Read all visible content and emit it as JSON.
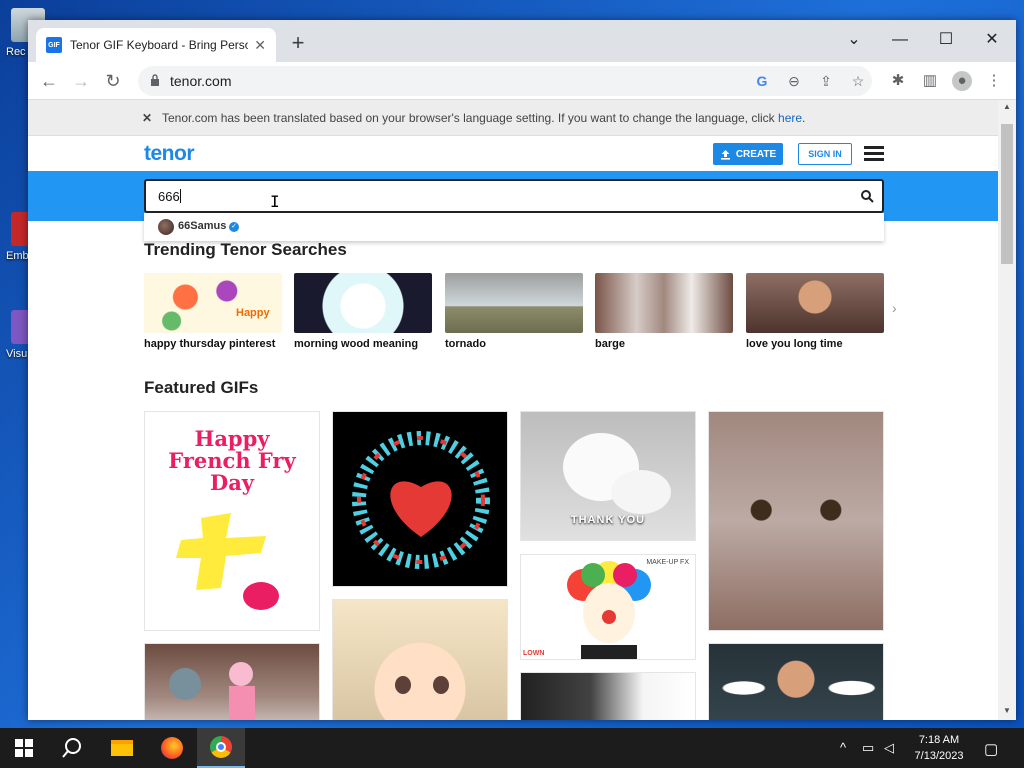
{
  "desktop": {
    "icons": [
      {
        "label": "Rec"
      },
      {
        "label": "Emb De"
      },
      {
        "label": "Visu"
      }
    ]
  },
  "browser": {
    "tab": {
      "title": "Tenor GIF Keyboard - Bring Personality",
      "favicon": "GIF"
    },
    "new_tab_glyph": "+",
    "address": {
      "url": "tenor.com"
    },
    "colors": {
      "accent": "#1e88e5",
      "band": "#2196f3"
    }
  },
  "translate_bar": {
    "message": "Tenor.com has been translated based on your browser's language setting. If you want to change the language, click ",
    "link": "here",
    "suffix": "."
  },
  "header": {
    "logo": "tenor",
    "create_label": "CREATE",
    "signin_label": "SIGN IN"
  },
  "search": {
    "value": "666",
    "suggestions": [
      {
        "name": "66Samus",
        "verified": true
      }
    ]
  },
  "trending": {
    "title": "Trending Tenor Searches",
    "items": [
      {
        "label": "happy thursday pinterest",
        "overlay": "Happy"
      },
      {
        "label": "morning wood meaning"
      },
      {
        "label": "tornado"
      },
      {
        "label": "barge"
      },
      {
        "label": "love you long time"
      }
    ]
  },
  "featured": {
    "title": "Featured GIFs",
    "gifs": [
      {
        "name": "happy-french-fry-day",
        "text_line1": "Happy",
        "text_line2": "French Fry",
        "text_line3": "Day"
      },
      {
        "name": "heart-wreath"
      },
      {
        "name": "thank-you-cat",
        "caption": "THANK YOU"
      },
      {
        "name": "cat-closeup"
      },
      {
        "name": "clown",
        "corner": "MAKE-UP FX",
        "corner2": "LOWN"
      },
      {
        "name": "girl-face"
      },
      {
        "name": "cartoon-cat"
      },
      {
        "name": "hands"
      },
      {
        "name": "man-smoke"
      }
    ]
  },
  "taskbar": {
    "time": "7:18 AM",
    "date": "7/13/2023"
  }
}
